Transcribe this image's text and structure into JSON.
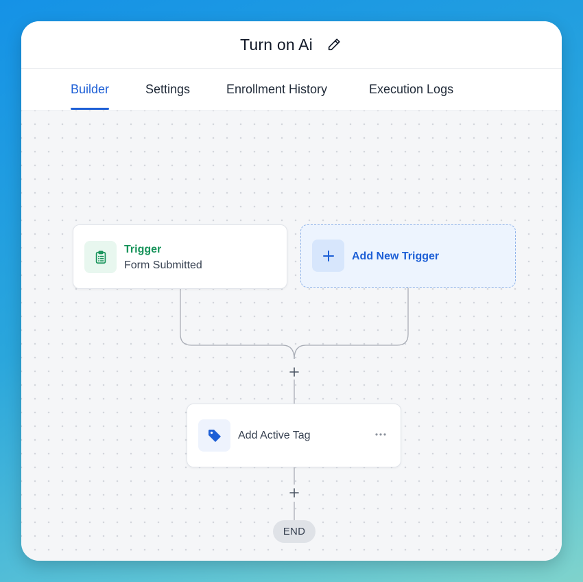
{
  "header": {
    "title": "Turn on Ai",
    "edit_icon": "pencil-icon"
  },
  "tabs": [
    {
      "label": "Builder",
      "active": true
    },
    {
      "label": "Settings",
      "active": false
    },
    {
      "label": "Enrollment History",
      "active": false
    },
    {
      "label": "Execution Logs",
      "active": false
    }
  ],
  "workflow": {
    "trigger": {
      "heading": "Trigger",
      "subtitle": "Form Submitted",
      "icon": "clipboard-list-icon"
    },
    "add_trigger": {
      "label": "Add New Trigger",
      "icon": "plus-icon"
    },
    "action": {
      "label": "Add Active Tag",
      "icon": "tag-icon",
      "menu_icon": "more-horizontal-icon"
    },
    "end_label": "END"
  },
  "colors": {
    "accent": "#1d5fd6",
    "trigger_green": "#17935a",
    "background_gradient_start": "#1592e6",
    "background_gradient_end": "#7fd3cc"
  }
}
